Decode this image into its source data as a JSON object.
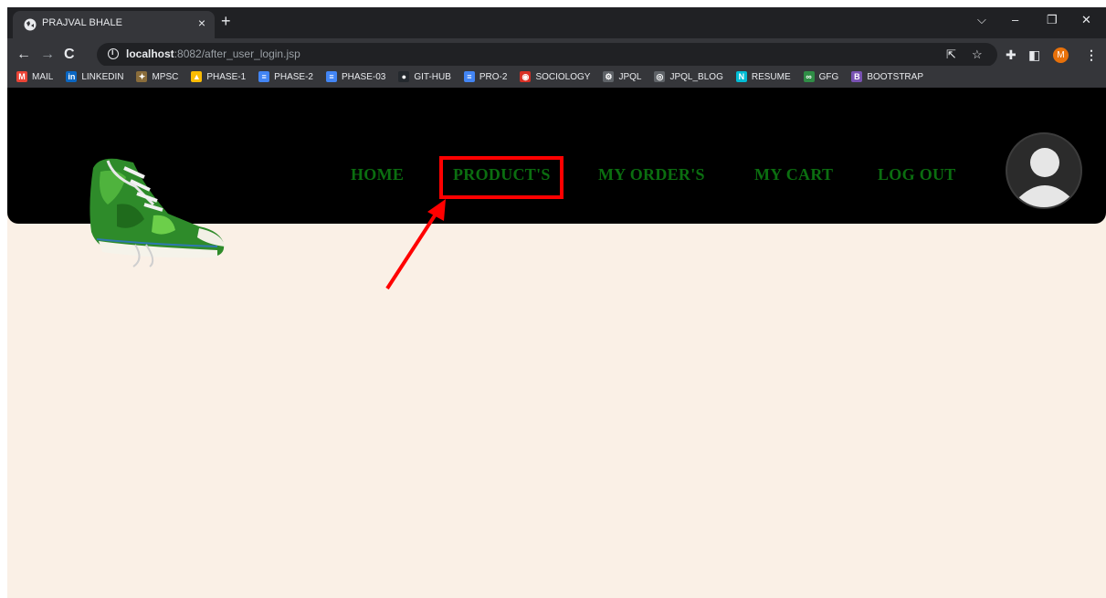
{
  "browser": {
    "tab_title": "PRAJVAL BHALE",
    "tab_close": "×",
    "new_tab": "+",
    "url_host": "localhost",
    "url_rest": ":8082/after_user_login.jsp",
    "profile_initial": "M"
  },
  "bookmarks": [
    {
      "label": "MAIL",
      "icon": "gmail-icon",
      "color": "#ea4335",
      "glyph": "M"
    },
    {
      "label": "LINKEDIN",
      "icon": "linkedin-icon",
      "color": "#0a66c2",
      "glyph": "in"
    },
    {
      "label": "MPSC",
      "icon": "emblem-icon",
      "color": "#8a6d3b",
      "glyph": "✦"
    },
    {
      "label": "PHASE-1",
      "icon": "drive-icon",
      "color": "#fbbc04",
      "glyph": "▲"
    },
    {
      "label": "PHASE-2",
      "icon": "docs-icon",
      "color": "#4285f4",
      "glyph": "≡"
    },
    {
      "label": "PHASE-03",
      "icon": "docs-icon",
      "color": "#4285f4",
      "glyph": "≡"
    },
    {
      "label": "GIT-HUB",
      "icon": "github-icon",
      "color": "#24292e",
      "glyph": "●"
    },
    {
      "label": "PRO-2",
      "icon": "docs-icon",
      "color": "#4285f4",
      "glyph": "≡"
    },
    {
      "label": "SOCIOLOGY",
      "icon": "sociology-icon",
      "color": "#d93025",
      "glyph": "◉"
    },
    {
      "label": "JPQL",
      "icon": "jpql-icon",
      "color": "#5f6368",
      "glyph": "⚙"
    },
    {
      "label": "JPQL_BLOG",
      "icon": "globe-icon",
      "color": "#5f6368",
      "glyph": "◎"
    },
    {
      "label": "RESUME",
      "icon": "resume-icon",
      "color": "#00bcd4",
      "glyph": "N"
    },
    {
      "label": "GFG",
      "icon": "gfg-icon",
      "color": "#2f8d46",
      "glyph": "∞"
    },
    {
      "label": "BOOTSTRAP",
      "icon": "bootstrap-icon",
      "color": "#7952b3",
      "glyph": "B"
    }
  ],
  "nav": {
    "home": "HOME",
    "products": "PRODUCT'S",
    "my_orders": "MY ORDER'S",
    "my_cart": "MY CART",
    "log_out": "LOG OUT"
  },
  "colors": {
    "nav_text": "#0b6e10",
    "header_bg": "#000000",
    "page_bg": "#faf0e6",
    "annotation": "#ff0000"
  }
}
